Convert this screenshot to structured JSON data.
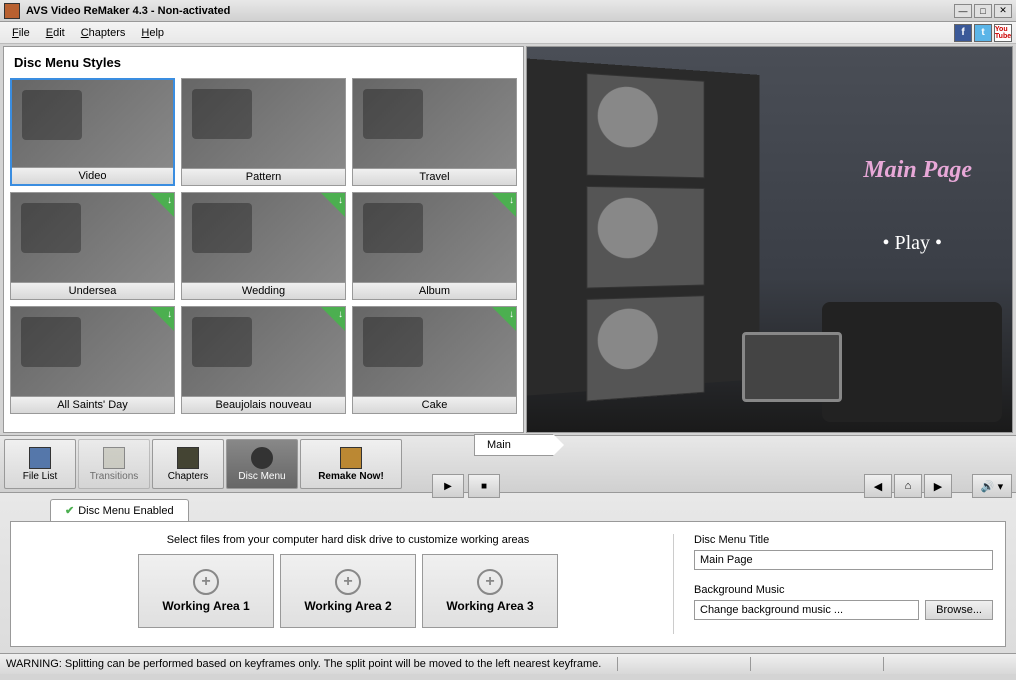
{
  "title": "AVS Video ReMaker 4.3 - Non-activated",
  "menu": {
    "file": "File",
    "edit": "Edit",
    "chapters": "Chapters",
    "help": "Help"
  },
  "panel_title": "Disc Menu Styles",
  "styles": [
    {
      "label": "Video",
      "selected": true,
      "badge": false
    },
    {
      "label": "Pattern",
      "selected": false,
      "badge": false
    },
    {
      "label": "Travel",
      "selected": false,
      "badge": false
    },
    {
      "label": "Undersea",
      "selected": false,
      "badge": true
    },
    {
      "label": "Wedding",
      "selected": false,
      "badge": true
    },
    {
      "label": "Album",
      "selected": false,
      "badge": true
    },
    {
      "label": "All Saints' Day",
      "selected": false,
      "badge": true
    },
    {
      "label": "Beaujolais nouveau",
      "selected": false,
      "badge": true
    },
    {
      "label": "Cake",
      "selected": false,
      "badge": true
    }
  ],
  "preview": {
    "title": "Main Page",
    "play": "• Play •"
  },
  "toolbar": {
    "filelist": "File List",
    "transitions": "Transitions",
    "chapters": "Chapters",
    "discmenu": "Disc Menu",
    "remake": "Remake Now!"
  },
  "breadcrumb": "Main",
  "tab_label": "Disc Menu Enabled",
  "wa_instruction": "Select files from your computer hard disk drive to customize working areas",
  "working_areas": [
    "Working Area 1",
    "Working Area 2",
    "Working Area 3"
  ],
  "form": {
    "title_label": "Disc Menu Title",
    "title_value": "Main Page",
    "music_label": "Background Music",
    "music_value": "Change background music ...",
    "browse": "Browse..."
  },
  "status": "WARNING: Splitting can be performed based on keyframes only. The split point will be moved to the left nearest keyframe."
}
